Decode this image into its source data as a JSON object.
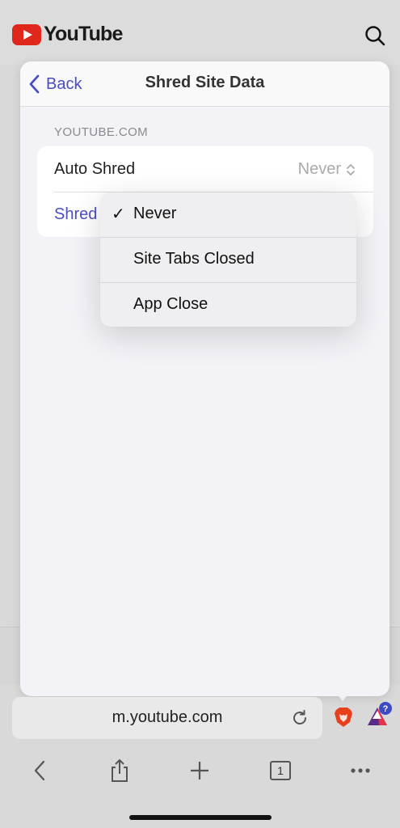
{
  "background": {
    "brand": "YouTube",
    "brand_color": "#e0271c"
  },
  "panel": {
    "back_label": "Back",
    "title": "Shred Site Data",
    "section_header": "YOUTUBE.COM",
    "auto_shred": {
      "label": "Auto Shred",
      "value": "Never"
    },
    "shred_label": "Shred"
  },
  "menu": {
    "options": [
      {
        "label": "Never",
        "selected": true
      },
      {
        "label": "Site Tabs Closed",
        "selected": false
      },
      {
        "label": "App Close",
        "selected": false
      }
    ],
    "check_glyph": "✓"
  },
  "urlbar": {
    "url": "m.youtube.com"
  },
  "toolbar": {
    "tab_count": "1",
    "icons": [
      "back-icon",
      "share-icon",
      "plus-icon",
      "tabs-icon",
      "more-icon"
    ]
  },
  "colors": {
    "accent": "#4a4cc2",
    "shield": "#e8401c"
  }
}
